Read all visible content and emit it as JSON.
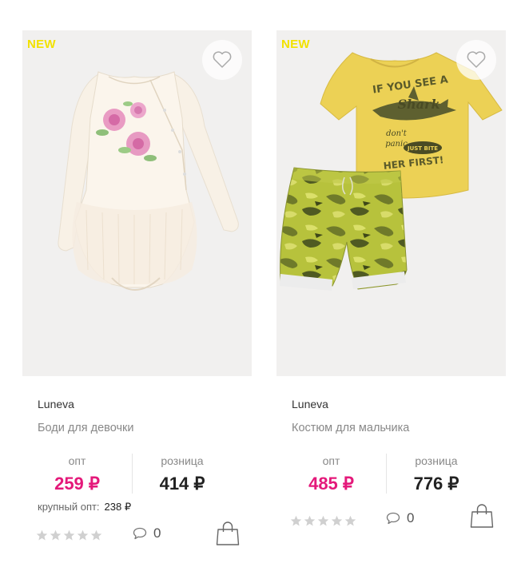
{
  "products": [
    {
      "badge": "NEW",
      "brand": "Luneva",
      "name": "Боди для девочки",
      "opt_label": "опт",
      "opt_price": "259 ₽",
      "retail_label": "розница",
      "retail_price": "414 ₽",
      "bulk_label": "крупный опт:",
      "bulk_price": "238 ₽",
      "rating": 0,
      "comments": "0",
      "image": "girl-bodysuit-photo"
    },
    {
      "badge": "NEW",
      "brand": "Luneva",
      "name": "Костюм для мальчика",
      "opt_label": "опт",
      "opt_price": "485 ₽",
      "retail_label": "розница",
      "retail_price": "776 ₽",
      "rating": 0,
      "comments": "0",
      "image": "boy-suit-photo",
      "tshirt_text": [
        "IF YOU SEE A",
        "Shark",
        "don't",
        "panic",
        "JUST BITE",
        "HER FIRST!"
      ]
    }
  ],
  "colors": {
    "accent_pink": "#e4197a",
    "new_badge": "#f2e200",
    "star_empty": "#d0d0d0"
  }
}
